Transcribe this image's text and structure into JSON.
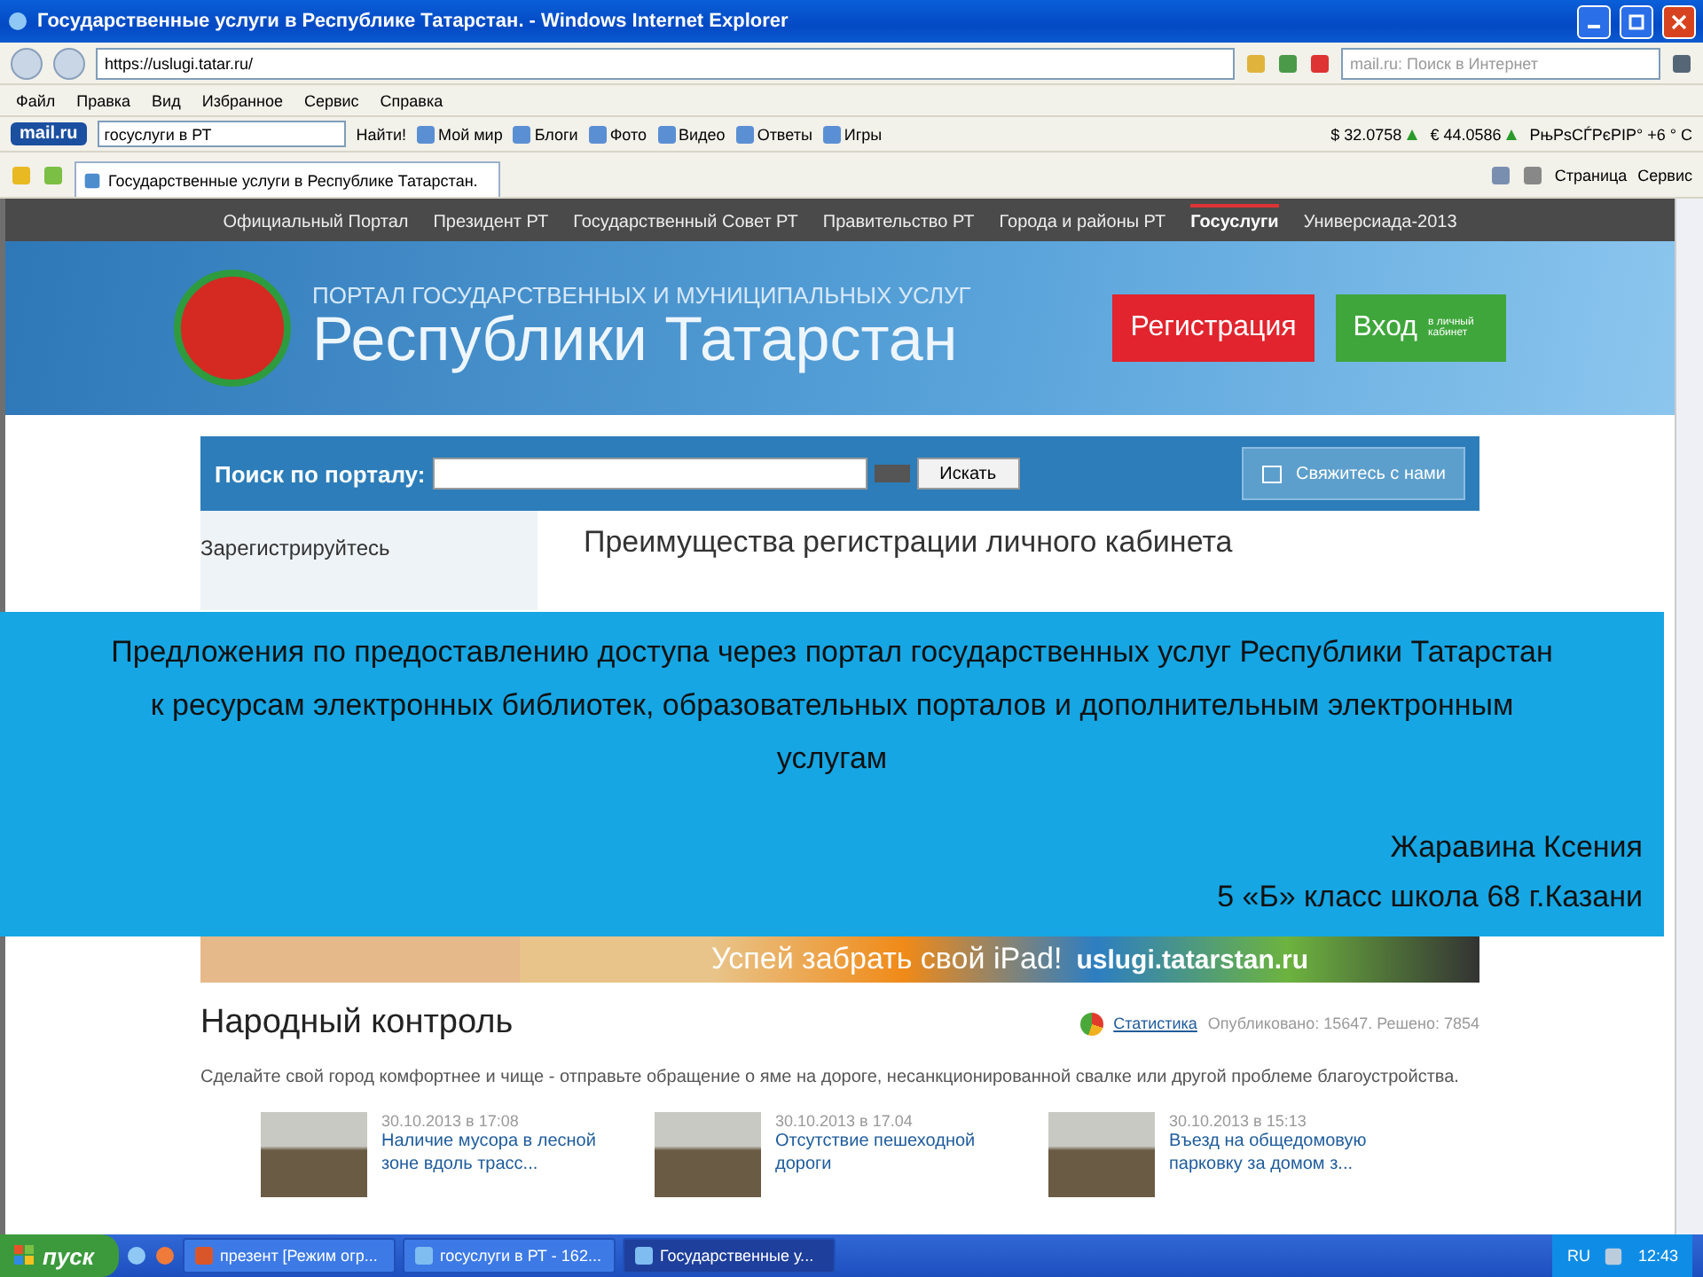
{
  "window": {
    "title": "Государственные услуги в Республике Татарстан. - Windows Internet Explorer"
  },
  "address": {
    "url": "https://uslugi.tatar.ru/",
    "search_placeholder": "mail.ru: Поиск в Интернет"
  },
  "menu": [
    "Файл",
    "Правка",
    "Вид",
    "Избранное",
    "Сервис",
    "Справка"
  ],
  "mail_toolbar": {
    "logo": "mail.ru",
    "query": "госуслуги в РТ",
    "find": "Найти!",
    "links": [
      "Мой мир",
      "Блоги",
      "Фото",
      "Видео",
      "Ответы",
      "Игры"
    ],
    "rates": [
      "$ 32.0758",
      "€ 44.0586"
    ],
    "weather": "РњРѕСЃРєРІР° +6 ° C"
  },
  "tab": {
    "title": "Государственные услуги в Республике Татарстан.",
    "commands": [
      "Страница",
      "Сервис"
    ]
  },
  "site_nav": [
    {
      "label": "Официальный Портал",
      "selected": false
    },
    {
      "label": "Президент РТ",
      "selected": false
    },
    {
      "label": "Государственный Совет РТ",
      "selected": false
    },
    {
      "label": "Правительство РТ",
      "selected": false
    },
    {
      "label": "Города и районы РТ",
      "selected": false
    },
    {
      "label": "Госуслуги",
      "selected": true
    },
    {
      "label": "Универсиада-2013",
      "selected": false
    }
  ],
  "header": {
    "subtitle": "ПОРТАЛ ГОСУДАРСТВЕННЫХ И МУНИЦИПАЛЬНЫХ УСЛУГ",
    "title": "Республики Татарстан",
    "register": "Регистрация",
    "login": "Вход",
    "login_note": "в личный кабинет"
  },
  "search": {
    "label": "Поиск по порталу:",
    "button": "Искать",
    "contact": "Свяжитесь с нами"
  },
  "register_box": {
    "title": "Зарегистрируйтесь",
    "heading": "Преимущества регистрации личного кабинета"
  },
  "banner": {
    "slogan": "Успей забрать свой iPad!",
    "site": "uslugi.tatarstan.ru"
  },
  "people_control": {
    "title": "Народный контроль",
    "stats_link": "Статистика",
    "stats": "Опубликовано: 15647. Решено: 7854",
    "description": "Сделайте свой город комфортнее и чище - отправьте обращение о яме на дороге, несанкционированной свалке или другой проблеме благоустройства.",
    "news": [
      {
        "date": "30.10.2013 в 17:08",
        "title": "Наличие мусора в лесной зоне вдоль трасс..."
      },
      {
        "date": "30.10.2013 в 17.04",
        "title": "Отсутствие пешеходной дороги"
      },
      {
        "date": "30.10.2013 в 15:13",
        "title": "Въезд на общедомовую парковку за домом з..."
      }
    ]
  },
  "overlay": {
    "text": "Предложения по предоставлению  доступа через портал государственных услуг Республики Татарстан к ресурсам электронных библиотек, образовательных порталов и дополнительным электронным услугам",
    "author": "Жаравина Ксения",
    "class": "5 «Б» класс  школа 68 г.Казани"
  },
  "taskbar": {
    "start": "пуск",
    "tasks": [
      {
        "label": "презент [Режим огр...",
        "selected": false,
        "kind": "ppt"
      },
      {
        "label": "госуслуги в РТ - 162...",
        "selected": false,
        "kind": "ie"
      },
      {
        "label": "Государственные у...",
        "selected": true,
        "kind": "ie"
      }
    ],
    "lang": "RU",
    "time": "12:43"
  }
}
